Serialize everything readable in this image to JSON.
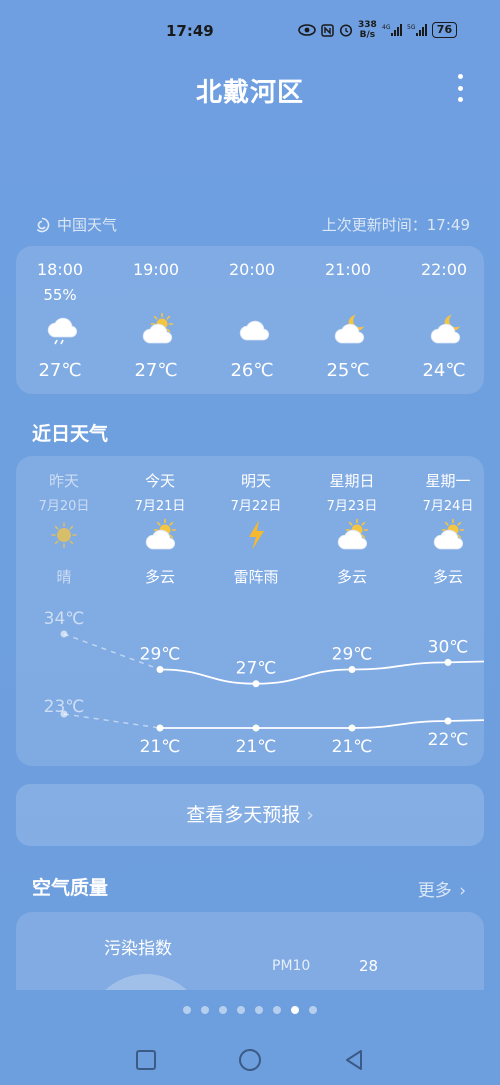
{
  "status": {
    "time": "17:49",
    "netspeed_value": "338",
    "netspeed_unit": "B/s",
    "battery": "76"
  },
  "header": {
    "title": "北戴河区"
  },
  "source": {
    "provider": "中国天气",
    "updated": "上次更新时间：17:49"
  },
  "hourly": [
    {
      "time": "18:00",
      "pct": "55%",
      "icon": "rain-cloud-icon",
      "temp": "27℃"
    },
    {
      "time": "19:00",
      "pct": "",
      "icon": "partly-cloudy-icon",
      "temp": "27℃"
    },
    {
      "time": "20:00",
      "pct": "",
      "icon": "cloud-icon",
      "temp": "26℃"
    },
    {
      "time": "21:00",
      "pct": "",
      "icon": "cloudy-night-icon",
      "temp": "25℃"
    },
    {
      "time": "22:00",
      "pct": "",
      "icon": "cloudy-night-icon",
      "temp": "24℃"
    }
  ],
  "daily_title": "近日天气",
  "daily": [
    {
      "name": "昨天",
      "date": "7月20日",
      "cond": "晴",
      "icon": "sun-icon",
      "high": 34,
      "low": 23,
      "high_label": "34℃",
      "low_label": "23℃",
      "past": true
    },
    {
      "name": "今天",
      "date": "7月21日",
      "cond": "多云",
      "icon": "partly-cloudy-icon",
      "high": 29,
      "low": 21,
      "high_label": "29℃",
      "low_label": "21℃",
      "past": false
    },
    {
      "name": "明天",
      "date": "7月22日",
      "cond": "雷阵雨",
      "icon": "lightning-icon",
      "high": 27,
      "low": 21,
      "high_label": "27℃",
      "low_label": "21℃",
      "past": false
    },
    {
      "name": "星期日",
      "date": "7月23日",
      "cond": "多云",
      "icon": "partly-cloudy-icon",
      "high": 29,
      "low": 21,
      "high_label": "29℃",
      "low_label": "21℃",
      "past": false
    },
    {
      "name": "星期一",
      "date": "7月24日",
      "cond": "多云",
      "icon": "partly-cloudy-icon",
      "high": 30,
      "low": 22,
      "high_label": "30℃",
      "low_label": "22℃",
      "past": false
    }
  ],
  "forecast_button": "查看多天预报",
  "air_quality": {
    "title": "空气质量",
    "more": "更多",
    "index_label": "污染指数",
    "pm10_label": "PM10",
    "pm10_value": "28"
  },
  "pager": {
    "count": 8,
    "active": 6
  },
  "colors": {
    "background": "#6f9fe0",
    "sun": "#f5c542",
    "lightning": "#f5b82e"
  }
}
